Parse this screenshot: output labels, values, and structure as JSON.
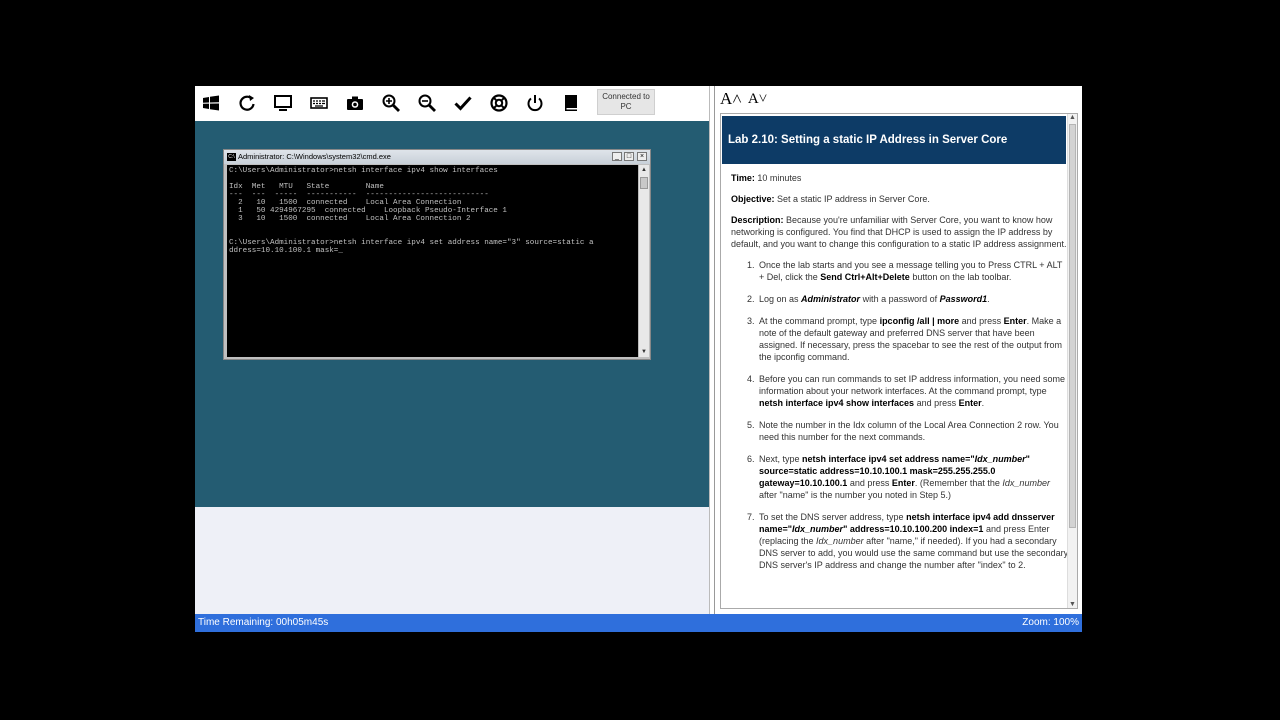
{
  "toolbar": {
    "icons": [
      "windows-icon",
      "refresh-icon",
      "monitor-icon",
      "keyboard-icon",
      "camera-icon",
      "zoom-in-icon",
      "zoom-out-icon",
      "check-icon",
      "help-icon",
      "power-icon",
      "book-icon"
    ],
    "connected_line1": "Connected to",
    "connected_line2": "PC"
  },
  "cmd": {
    "title": "Administrator: C:\\Windows\\system32\\cmd.exe",
    "icon_text": "C:\\",
    "minimize": "_",
    "maximize": "□",
    "close": "×",
    "lines": [
      "C:\\Users\\Administrator>netsh interface ipv4 show interfaces",
      "",
      "Idx  Met   MTU   State        Name",
      "---  ---  -----  -----------  ---------------------------",
      "  2   10   1500  connected    Local Area Connection",
      "  1   50 4294967295  connected    Loopback Pseudo-Interface 1",
      "  3   10   1500  connected    Local Area Connection 2",
      "",
      "",
      "C:\\Users\\Administrator>netsh interface ipv4 set address name=\"3\" source=static a",
      "ddress=10.10.100.1 mask=_"
    ]
  },
  "panel": {
    "font_increase": "A˄",
    "font_decrease": "A˅",
    "lab_title": "Lab 2.10: Setting a static IP Address in Server Core",
    "time_label": "Time:",
    "time_value": " 10 minutes",
    "objective_label": "Objective:",
    "objective_value": " Set a static IP address in Server Core.",
    "description_label": "Description:",
    "description_value": "  Because you're unfamiliar with Server Core, you want to know how networking is configured. You find that DHCP is used to assign the IP address by default, and you want to change this configuration to a static IP address assignment.",
    "steps": [
      {
        "n": "1.",
        "parts": [
          [
            "t",
            "Once the lab starts and you see a message telling you to Press CTRL + ALT + Del, click the "
          ],
          [
            "b",
            "Send Ctrl+Alt+Delete"
          ],
          [
            "t",
            " button on the lab toolbar."
          ]
        ]
      },
      {
        "n": "2.",
        "parts": [
          [
            "t",
            "Log on as "
          ],
          [
            "bi",
            "Administrator"
          ],
          [
            "t",
            " with a password of "
          ],
          [
            "bi",
            "Password1"
          ],
          [
            "t",
            "."
          ]
        ]
      },
      {
        "n": "3.",
        "parts": [
          [
            "t",
            "At the command prompt, type "
          ],
          [
            "b",
            "ipconfig /all | more"
          ],
          [
            "t",
            " and press "
          ],
          [
            "b",
            "Enter"
          ],
          [
            "t",
            ". Make a note of the default gateway and preferred DNS server that have been assigned. If necessary, press the spacebar to see the rest of the output from the ipconfig command."
          ]
        ]
      },
      {
        "n": "4.",
        "parts": [
          [
            "t",
            "Before you can run commands to set IP address information, you need some information about your network interfaces. At the command prompt, type "
          ],
          [
            "b",
            "netsh interface ipv4 show interfaces"
          ],
          [
            "t",
            " and press "
          ],
          [
            "b",
            "Enter"
          ],
          [
            "t",
            "."
          ]
        ]
      },
      {
        "n": "5.",
        "parts": [
          [
            "t",
            "Note the number in the Idx column of the Local Area Connection 2 row. You need this number for the next commands."
          ]
        ]
      },
      {
        "n": "6.",
        "parts": [
          [
            "t",
            "Next, type "
          ],
          [
            "b",
            "netsh interface ipv4 set address name=\""
          ],
          [
            "bi",
            "Idx_number"
          ],
          [
            "b",
            "\" source=static address=10.10.100.1 mask=255.255.255.0 gateway=10.10.100.1"
          ],
          [
            "t",
            " and press "
          ],
          [
            "b",
            "Enter"
          ],
          [
            "t",
            ". (Remember that the "
          ],
          [
            "i",
            "Idx_number"
          ],
          [
            "t",
            " after \"name\" is the number you noted in Step 5.)"
          ]
        ]
      },
      {
        "n": "7.",
        "parts": [
          [
            "t",
            "To set the DNS server address, type "
          ],
          [
            "b",
            "netsh interface ipv4 add dnsserver name=\""
          ],
          [
            "bi",
            "Idx_number"
          ],
          [
            "b",
            "\" address=10.10.100.200 index=1"
          ],
          [
            "t",
            " and press Enter (replacing the "
          ],
          [
            "i",
            "Idx_number"
          ],
          [
            "t",
            " after \"name,\" if needed). If you had a secondary DNS server to add, you would use the same command but use the secondary DNS server's IP address and change the number after \"index\" to 2."
          ]
        ]
      }
    ]
  },
  "status": {
    "time_remaining": "Time Remaining: 00h05m45s",
    "zoom": "Zoom: 100%"
  }
}
